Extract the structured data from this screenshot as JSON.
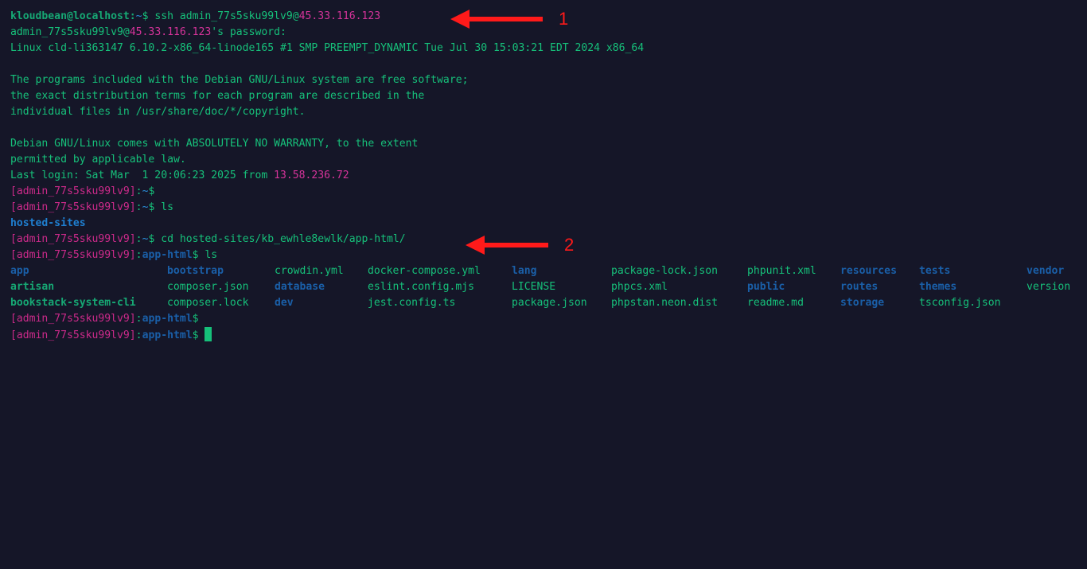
{
  "terminal": {
    "local_prompt": {
      "user_host": "kloudbean@localhost",
      "sep": ":",
      "path": "~",
      "symbol": "$"
    },
    "ssh_command": {
      "cmd": "ssh admin_77s5sku99lv9@",
      "host": "45.33.116.123"
    },
    "password_prompt": {
      "user": "admin_77s5sku99lv9@",
      "host": "45.33.116.123",
      "suffix": "'s password:"
    },
    "uname": "Linux cld-li363147 6.10.2-x86_64-linode165 #1 SMP PREEMPT_DYNAMIC Tue Jul 30 15:03:21 EDT 2024 x86_64",
    "motd": [
      "The programs included with the Debian GNU/Linux system are free software;",
      "the exact distribution terms for each program are described in the",
      "individual files in /usr/share/doc/*/copyright.",
      "",
      "Debian GNU/Linux comes with ABSOLUTELY NO WARRANTY, to the extent",
      "permitted by applicable law."
    ],
    "last_login": {
      "text": "Last login: Sat Mar  1 20:06:23 2025 from ",
      "ip": "13.58.236.72"
    },
    "remote_prompt": {
      "user": "[admin_77s5sku99lv9]",
      "sep": ":",
      "home": "~",
      "cwd": "app-html",
      "symbol": "$"
    },
    "commands": {
      "empty": "",
      "ls": " ls",
      "cd": " cd hosted-sites/kb_ewhle8ewlk/app-html/"
    },
    "home_listing": [
      "hosted-sites"
    ],
    "app_listing": [
      {
        "name": "app",
        "type": "dir"
      },
      {
        "name": "artisan",
        "type": "exec"
      },
      {
        "name": "bookstack-system-cli",
        "type": "exec"
      },
      {
        "name": "bootstrap",
        "type": "dir"
      },
      {
        "name": "composer.json",
        "type": "file"
      },
      {
        "name": "composer.lock",
        "type": "file"
      },
      {
        "name": "crowdin.yml",
        "type": "file"
      },
      {
        "name": "database",
        "type": "dir"
      },
      {
        "name": "dev",
        "type": "dir"
      },
      {
        "name": "docker-compose.yml",
        "type": "file"
      },
      {
        "name": "eslint.config.mjs",
        "type": "file"
      },
      {
        "name": "jest.config.ts",
        "type": "file"
      },
      {
        "name": "lang",
        "type": "dir"
      },
      {
        "name": "LICENSE",
        "type": "file"
      },
      {
        "name": "package.json",
        "type": "file"
      },
      {
        "name": "package-lock.json",
        "type": "file"
      },
      {
        "name": "phpcs.xml",
        "type": "file"
      },
      {
        "name": "phpstan.neon.dist",
        "type": "file"
      },
      {
        "name": "phpunit.xml",
        "type": "file"
      },
      {
        "name": "public",
        "type": "dir"
      },
      {
        "name": "readme.md",
        "type": "file"
      },
      {
        "name": "resources",
        "type": "dir"
      },
      {
        "name": "routes",
        "type": "dir"
      },
      {
        "name": "storage",
        "type": "dir"
      },
      {
        "name": "tests",
        "type": "dir"
      },
      {
        "name": "themes",
        "type": "dir"
      },
      {
        "name": "tsconfig.json",
        "type": "file"
      },
      {
        "name": "vendor",
        "type": "dir"
      },
      {
        "name": "version",
        "type": "file"
      }
    ]
  },
  "annotations": [
    {
      "label": "1",
      "color": "#ff1a1a"
    },
    {
      "label": "2",
      "color": "#ff1a1a"
    }
  ]
}
